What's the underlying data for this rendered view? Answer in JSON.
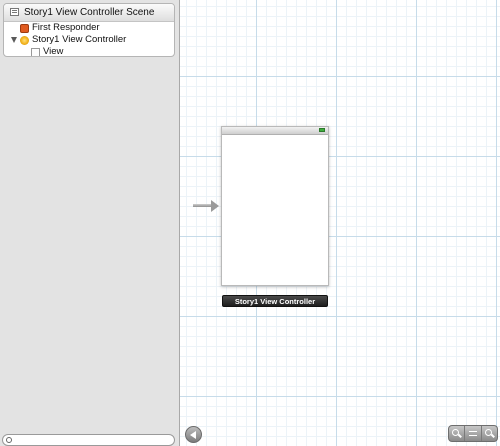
{
  "outline": {
    "scene_title": "Story1 View Controller Scene",
    "items": [
      {
        "label": "First Responder",
        "icon": "first-responder-icon"
      },
      {
        "label": "Story1 View Controller",
        "icon": "view-controller-icon",
        "expanded": true
      },
      {
        "label": "View",
        "icon": "view-icon"
      }
    ],
    "search": {
      "placeholder": ""
    }
  },
  "canvas": {
    "view_controller_label": "Story1 View Controller"
  },
  "colors": {
    "grid_major": "#c7dcea",
    "grid_minor": "#ecf3f8",
    "panel_bg": "#e3e3e3"
  }
}
